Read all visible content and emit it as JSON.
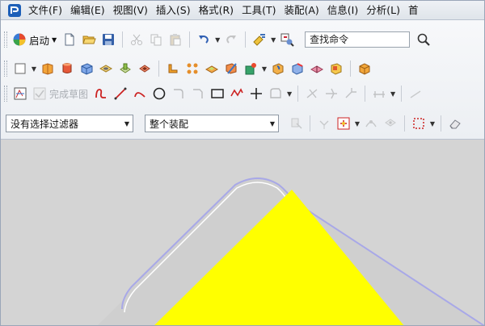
{
  "app": {
    "logo_icon": "nx-logo-icon"
  },
  "menu": {
    "items": [
      {
        "label": "文件(F)"
      },
      {
        "label": "编辑(E)"
      },
      {
        "label": "视图(V)"
      },
      {
        "label": "插入(S)"
      },
      {
        "label": "格式(R)"
      },
      {
        "label": "工具(T)"
      },
      {
        "label": "装配(A)"
      },
      {
        "label": "信息(I)"
      },
      {
        "label": "分析(L)"
      },
      {
        "label": "首"
      }
    ]
  },
  "toolbar": {
    "start_label": "启动",
    "command_search_value": "查找命令",
    "finish_sketch_label": "完成草图",
    "selection_filter": "没有选择过滤器",
    "scope_filter": "整个装配"
  },
  "colors": {
    "face_fill": "#ffff00",
    "body_fill": "#cfcfcf",
    "edge_highlight": "#a8a8e8",
    "background": "#d4d4d4"
  }
}
